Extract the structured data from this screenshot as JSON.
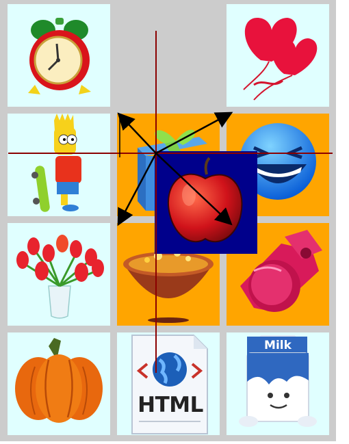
{
  "puzzle": {
    "tiles": [
      {
        "id": "r1c1",
        "icon": "alarm-clock-icon",
        "background": "#e0ffff"
      },
      {
        "id": "r1c2",
        "icon": "empty-slot",
        "background": "#cccccc"
      },
      {
        "id": "r1c3",
        "icon": "heart-balloons-icon",
        "background": "#e0ffff"
      },
      {
        "id": "r2c1",
        "icon": "cartoon-boy-skateboard-icon",
        "background": "#e0ffff"
      },
      {
        "id": "r2c2",
        "icon": "gift-box-icon",
        "background": "#ffa500"
      },
      {
        "id": "r2c3",
        "icon": "laughing-smiley-icon",
        "background": "#ffa500"
      },
      {
        "id": "r3c1",
        "icon": "tulip-vase-icon",
        "background": "#e0ffff"
      },
      {
        "id": "r3c2",
        "icon": "magic-cauldron-icon",
        "background": "#ffa500"
      },
      {
        "id": "r3c3",
        "icon": "whistle-icon",
        "background": "#ffa500"
      },
      {
        "id": "r4c1",
        "icon": "pumpkin-icon",
        "background": "#e0ffff"
      },
      {
        "id": "r4c2",
        "icon": "html-file-icon",
        "background": "#e0ffff"
      },
      {
        "id": "r4c3",
        "icon": "milk-carton-icon",
        "background": "#e0ffff"
      }
    ],
    "dragged_tile": {
      "icon": "apple-icon",
      "background": "#00008b"
    }
  },
  "labels": {
    "html_text": "HTML",
    "milk_text": "Milk"
  },
  "colors": {
    "board": "#cccccc",
    "light_tile": "#e0ffff",
    "orange_tile": "#ffa500",
    "dragged_tile": "#00008b",
    "crosshair": "#8b0000",
    "arrows": "#000000"
  }
}
